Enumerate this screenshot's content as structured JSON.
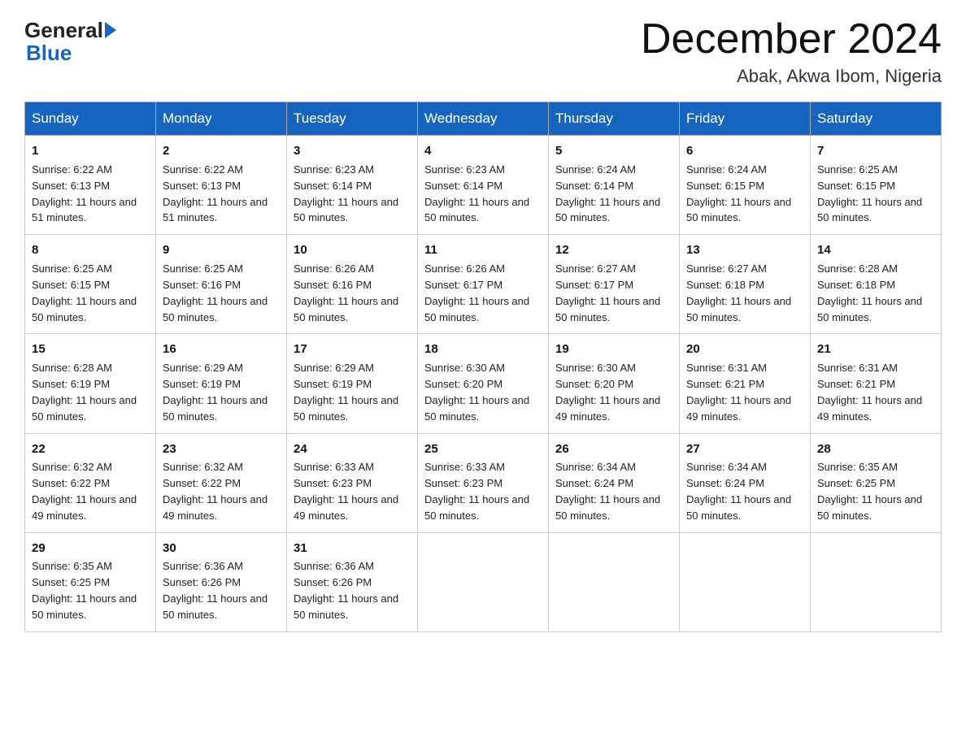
{
  "header": {
    "logo_general": "General",
    "logo_blue": "Blue",
    "month_title": "December 2024",
    "subtitle": "Abak, Akwa Ibom, Nigeria"
  },
  "weekdays": [
    "Sunday",
    "Monday",
    "Tuesday",
    "Wednesday",
    "Thursday",
    "Friday",
    "Saturday"
  ],
  "weeks": [
    [
      {
        "day": "1",
        "sunrise": "6:22 AM",
        "sunset": "6:13 PM",
        "daylight": "11 hours and 51 minutes."
      },
      {
        "day": "2",
        "sunrise": "6:22 AM",
        "sunset": "6:13 PM",
        "daylight": "11 hours and 51 minutes."
      },
      {
        "day": "3",
        "sunrise": "6:23 AM",
        "sunset": "6:14 PM",
        "daylight": "11 hours and 50 minutes."
      },
      {
        "day": "4",
        "sunrise": "6:23 AM",
        "sunset": "6:14 PM",
        "daylight": "11 hours and 50 minutes."
      },
      {
        "day": "5",
        "sunrise": "6:24 AM",
        "sunset": "6:14 PM",
        "daylight": "11 hours and 50 minutes."
      },
      {
        "day": "6",
        "sunrise": "6:24 AM",
        "sunset": "6:15 PM",
        "daylight": "11 hours and 50 minutes."
      },
      {
        "day": "7",
        "sunrise": "6:25 AM",
        "sunset": "6:15 PM",
        "daylight": "11 hours and 50 minutes."
      }
    ],
    [
      {
        "day": "8",
        "sunrise": "6:25 AM",
        "sunset": "6:15 PM",
        "daylight": "11 hours and 50 minutes."
      },
      {
        "day": "9",
        "sunrise": "6:25 AM",
        "sunset": "6:16 PM",
        "daylight": "11 hours and 50 minutes."
      },
      {
        "day": "10",
        "sunrise": "6:26 AM",
        "sunset": "6:16 PM",
        "daylight": "11 hours and 50 minutes."
      },
      {
        "day": "11",
        "sunrise": "6:26 AM",
        "sunset": "6:17 PM",
        "daylight": "11 hours and 50 minutes."
      },
      {
        "day": "12",
        "sunrise": "6:27 AM",
        "sunset": "6:17 PM",
        "daylight": "11 hours and 50 minutes."
      },
      {
        "day": "13",
        "sunrise": "6:27 AM",
        "sunset": "6:18 PM",
        "daylight": "11 hours and 50 minutes."
      },
      {
        "day": "14",
        "sunrise": "6:28 AM",
        "sunset": "6:18 PM",
        "daylight": "11 hours and 50 minutes."
      }
    ],
    [
      {
        "day": "15",
        "sunrise": "6:28 AM",
        "sunset": "6:19 PM",
        "daylight": "11 hours and 50 minutes."
      },
      {
        "day": "16",
        "sunrise": "6:29 AM",
        "sunset": "6:19 PM",
        "daylight": "11 hours and 50 minutes."
      },
      {
        "day": "17",
        "sunrise": "6:29 AM",
        "sunset": "6:19 PM",
        "daylight": "11 hours and 50 minutes."
      },
      {
        "day": "18",
        "sunrise": "6:30 AM",
        "sunset": "6:20 PM",
        "daylight": "11 hours and 50 minutes."
      },
      {
        "day": "19",
        "sunrise": "6:30 AM",
        "sunset": "6:20 PM",
        "daylight": "11 hours and 49 minutes."
      },
      {
        "day": "20",
        "sunrise": "6:31 AM",
        "sunset": "6:21 PM",
        "daylight": "11 hours and 49 minutes."
      },
      {
        "day": "21",
        "sunrise": "6:31 AM",
        "sunset": "6:21 PM",
        "daylight": "11 hours and 49 minutes."
      }
    ],
    [
      {
        "day": "22",
        "sunrise": "6:32 AM",
        "sunset": "6:22 PM",
        "daylight": "11 hours and 49 minutes."
      },
      {
        "day": "23",
        "sunrise": "6:32 AM",
        "sunset": "6:22 PM",
        "daylight": "11 hours and 49 minutes."
      },
      {
        "day": "24",
        "sunrise": "6:33 AM",
        "sunset": "6:23 PM",
        "daylight": "11 hours and 49 minutes."
      },
      {
        "day": "25",
        "sunrise": "6:33 AM",
        "sunset": "6:23 PM",
        "daylight": "11 hours and 50 minutes."
      },
      {
        "day": "26",
        "sunrise": "6:34 AM",
        "sunset": "6:24 PM",
        "daylight": "11 hours and 50 minutes."
      },
      {
        "day": "27",
        "sunrise": "6:34 AM",
        "sunset": "6:24 PM",
        "daylight": "11 hours and 50 minutes."
      },
      {
        "day": "28",
        "sunrise": "6:35 AM",
        "sunset": "6:25 PM",
        "daylight": "11 hours and 50 minutes."
      }
    ],
    [
      {
        "day": "29",
        "sunrise": "6:35 AM",
        "sunset": "6:25 PM",
        "daylight": "11 hours and 50 minutes."
      },
      {
        "day": "30",
        "sunrise": "6:36 AM",
        "sunset": "6:26 PM",
        "daylight": "11 hours and 50 minutes."
      },
      {
        "day": "31",
        "sunrise": "6:36 AM",
        "sunset": "6:26 PM",
        "daylight": "11 hours and 50 minutes."
      },
      null,
      null,
      null,
      null
    ]
  ]
}
